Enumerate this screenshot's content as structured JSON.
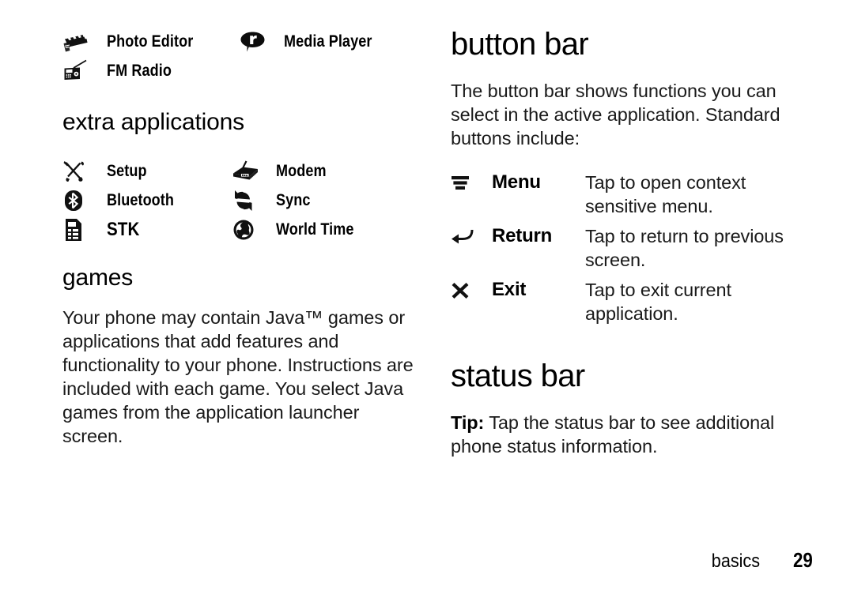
{
  "page": {
    "footer_section": "basics",
    "footer_page_number": "29"
  },
  "left_column": {
    "top_apps": {
      "rows": [
        {
          "left": {
            "icon": "clapperboard-icon",
            "label": "Photo Editor"
          },
          "right": {
            "icon": "media-player-bubble-icon",
            "label": "Media Player"
          }
        },
        {
          "left": {
            "icon": "radio-icon",
            "label": "FM Radio"
          },
          "right": {
            "icon": "",
            "label": ""
          }
        }
      ]
    },
    "extra_applications": {
      "heading": "extra applications",
      "rows": [
        {
          "left": {
            "icon": "tools-icon",
            "label": "Setup"
          },
          "right": {
            "icon": "modem-router-icon",
            "label": "Modem"
          }
        },
        {
          "left": {
            "icon": "bluetooth-icon",
            "label": "Bluetooth"
          },
          "right": {
            "icon": "sync-arrows-icon",
            "label": "Sync"
          }
        },
        {
          "left": {
            "icon": "sim-card-icon",
            "label": "STK"
          },
          "right": {
            "icon": "globe-icon",
            "label": "World Time"
          }
        }
      ]
    },
    "games": {
      "heading": "games",
      "paragraph": "Your phone may contain Java™ games or applications that add features and functionality to your phone. Instructions are included with each game. You select Java games from the application launcher screen."
    }
  },
  "right_column": {
    "button_bar": {
      "heading": "button bar",
      "intro": "The button bar shows functions you can select in the active application. Standard buttons include:",
      "buttons": [
        {
          "icon": "menu-bars-icon",
          "name": "Menu",
          "description": "Tap to open context sensitive menu."
        },
        {
          "icon": "return-arrow-icon",
          "name": "Return",
          "description": "Tap to return to previous screen."
        },
        {
          "icon": "close-x-icon",
          "name": "Exit",
          "description": "Tap to exit current application."
        }
      ]
    },
    "status_bar": {
      "heading": "status bar",
      "tip_label": "Tip:",
      "tip_text": " Tap the status bar to see additional phone status information."
    }
  },
  "colors": {
    "text": "#000000",
    "body_text": "#1a1a1a",
    "background": "#ffffff"
  }
}
